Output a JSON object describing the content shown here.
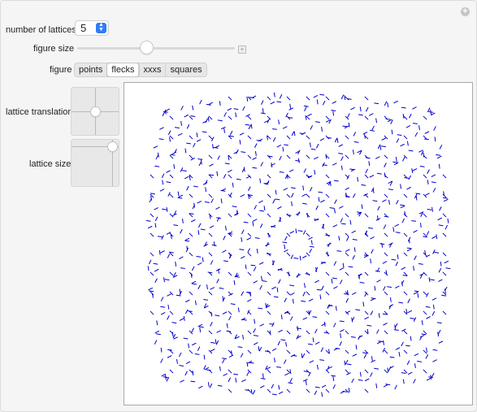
{
  "controls": {
    "lattices_label": "number of lattices",
    "lattices_value": "5",
    "figure_size_label": "figure size",
    "figure_size_level": 0.44,
    "figure_label": "figure",
    "figure_options": [
      "points",
      "flecks",
      "xxxs",
      "squares"
    ],
    "figure_selected": "flecks",
    "translation_label": "lattice translation",
    "size_label": "lattice size"
  },
  "plot": {
    "stroke_color": "#0000cc",
    "lattice_count": 5
  }
}
